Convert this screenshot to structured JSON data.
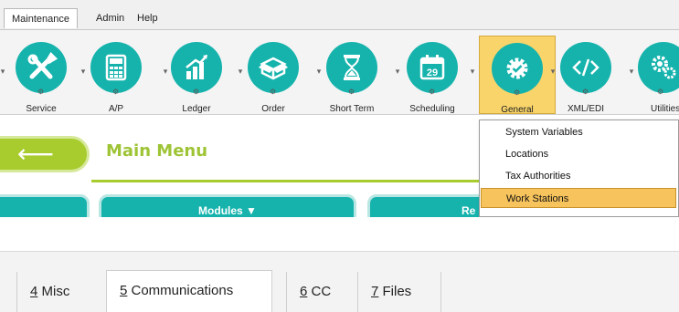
{
  "menu": {
    "tabs": [
      {
        "label": "Maintenance",
        "active": true
      },
      {
        "label": "Admin",
        "active": false
      },
      {
        "label": "Help",
        "active": false
      }
    ]
  },
  "ribbon": {
    "buttons": [
      {
        "label": "Service",
        "icon": "wrench-screwdriver-icon"
      },
      {
        "label": "A/P",
        "icon": "calculator-icon"
      },
      {
        "label": "Ledger",
        "icon": "bar-chart-icon"
      },
      {
        "label": "Order",
        "icon": "open-box-icon"
      },
      {
        "label": "Short Term",
        "icon": "hourglass-icon"
      },
      {
        "label": "Scheduling",
        "icon": "calendar-icon",
        "calendar_day": "29"
      },
      {
        "label": "General",
        "icon": "gear-check-icon",
        "selected": true
      },
      {
        "label": "XML/EDI",
        "icon": "code-icon"
      },
      {
        "label": "Utilities",
        "icon": "gears-icon"
      }
    ],
    "accent_color": "#16b3ad",
    "selected_color": "#f9d46a"
  },
  "main": {
    "back_arrow": "⟵",
    "title": "Main Menu",
    "modules_label": "Modules ▼",
    "right_button_label": "Re",
    "accent_green": "#a8cc2e"
  },
  "dropdown": {
    "items": [
      {
        "label": "System Variables"
      },
      {
        "label": "Locations"
      },
      {
        "label": "Tax Authorities"
      },
      {
        "label": "Work Stations",
        "highlighted": true
      }
    ]
  },
  "bottom_tabs": [
    {
      "key": "4",
      "rest": " Misc",
      "active": false
    },
    {
      "key": "5",
      "rest": " Communications",
      "active": true
    },
    {
      "key": "6",
      "rest": " CC",
      "active": false
    },
    {
      "key": "7",
      "rest": " Files",
      "active": false
    }
  ]
}
